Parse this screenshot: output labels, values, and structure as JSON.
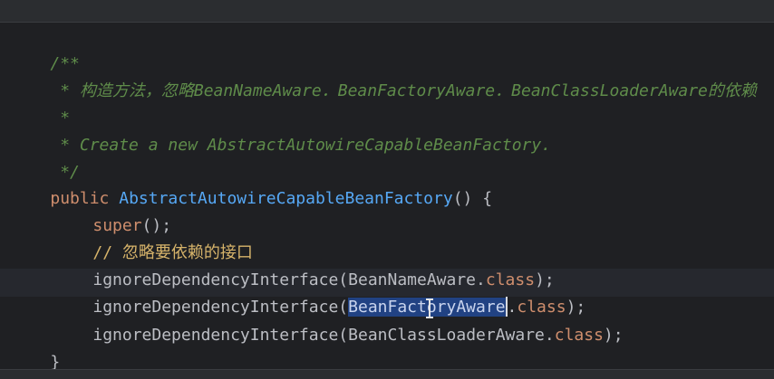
{
  "code": {
    "doc_open": "/**",
    "doc_line1": " * 构造方法，忽略BeanNameAware．BeanFactoryAware．BeanClassLoaderAware的依赖",
    "doc_star": " *",
    "doc_line2": " * Create a new AbstractAutowireCapableBeanFactory.",
    "doc_close": " */",
    "kw_public": "public",
    "ctor_name": "AbstractAutowireCapableBeanFactory",
    "ctor_tail": "() {",
    "kw_super": "super",
    "super_tail": "();",
    "comment_ignore": "// 忽略要依赖的接口",
    "call_name": "ignoreDependencyInterface",
    "paren_open": "(",
    "arg1": "BeanNameAware",
    "arg2": "BeanFactoryAware",
    "arg3_before_cursor": "BeanClassL",
    "arg3_after_cursor": "oaderAware",
    "dot": ".",
    "kw_class": "class",
    "call_tail": ");",
    "close_brace": "}"
  },
  "colors": {
    "background": "#1f2023",
    "doc_comment": "#5f8c4a",
    "line_comment": "#d6b36a",
    "keyword": "#cf8e6d",
    "function": "#56a8f5",
    "selection": "#214283"
  },
  "icons": {
    "mouse_cursor": "ibeam-cursor-icon"
  }
}
